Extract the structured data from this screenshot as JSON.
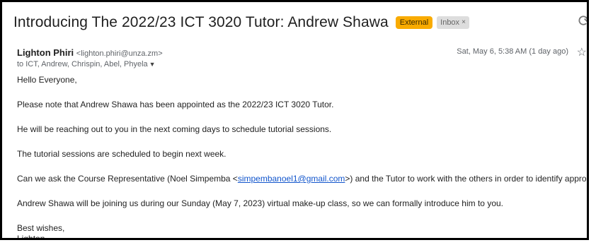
{
  "email": {
    "subject": "Introducing The 2022/23 ICT 3020 Tutor: Andrew Shawa",
    "labels": {
      "external": "External",
      "inbox": "Inbox",
      "inbox_close": "×"
    },
    "sender": {
      "name": "Lighton Phiri",
      "email": "<lighton.phiri@unza.zm>"
    },
    "recipients": "to ICT, Andrew, Chrispin, Abel, Phyela",
    "date": "Sat, May 6, 5:38 AM (1 day ago)",
    "body": {
      "greeting": "Hello Everyone,",
      "p1": "Please note that Andrew Shawa has been appointed as the 2022/23 ICT 3020 Tutor.",
      "p2": "He will be reaching out to you in the next coming days to schedule tutorial sessions.",
      "p3": "The tutorial sessions are scheduled to begin next week.",
      "p4_before": "Can we ask the Course Representative (Noel Simpemba <",
      "p4_link": "simpembanoel1@gmail.com",
      "p4_after": ">) and the Tutor to work with the others in order to identify appropriate turial slots?",
      "p5": "Andrew Shawa will be joining us during our Sunday (May 7, 2023) virtual make-up class, so we can formally introduce him to you.",
      "closing": "Best wishes,",
      "signature": "Lighton"
    }
  },
  "colors": {
    "external_badge": "#f9ab00",
    "inbox_badge": "#dddddd",
    "link": "#1155cc"
  }
}
